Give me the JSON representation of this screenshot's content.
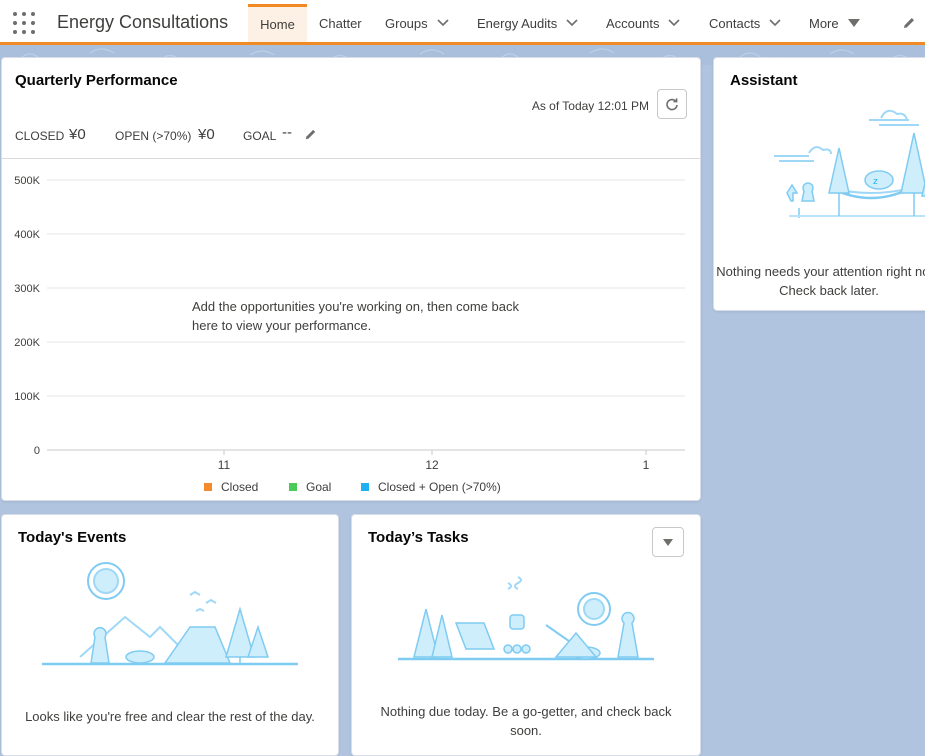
{
  "app": {
    "name": "Energy Consultations",
    "nav": [
      {
        "label": "Home",
        "active": true,
        "has_menu": false
      },
      {
        "label": "Chatter",
        "active": false,
        "has_menu": false
      },
      {
        "label": "Groups",
        "active": false,
        "has_menu": true
      },
      {
        "label": "Energy Audits",
        "active": false,
        "has_menu": true
      },
      {
        "label": "Accounts",
        "active": false,
        "has_menu": true
      },
      {
        "label": "Contacts",
        "active": false,
        "has_menu": true
      },
      {
        "label": "More",
        "active": false,
        "has_menu": true
      }
    ],
    "accent_color": "#f08a24"
  },
  "performance": {
    "title": "Quarterly Performance",
    "as_of": "As of Today 12:01 PM",
    "closed_label": "CLOSED",
    "closed_value": "¥0",
    "open_label": "OPEN (>70%)",
    "open_value": "¥0",
    "goal_label": "GOAL",
    "goal_value": "--",
    "empty_message": "Add the opportunities you're working on, then come back here to view your performance."
  },
  "chart_data": {
    "type": "line",
    "categories": [
      "11",
      "12",
      "1"
    ],
    "y_ticks": [
      "500K",
      "400K",
      "300K",
      "200K",
      "100K",
      "0"
    ],
    "ylim": [
      0,
      500000
    ],
    "grid": true,
    "legend_position": "bottom",
    "series": [
      {
        "name": "Closed",
        "color": "#f38b2c",
        "values": []
      },
      {
        "name": "Goal",
        "color": "#4bca58",
        "values": []
      },
      {
        "name": "Closed + Open (>70%)",
        "color": "#1fb0f0",
        "values": []
      }
    ]
  },
  "assistant": {
    "title": "Assistant",
    "message": "Nothing needs your attention right now. Check back later."
  },
  "events": {
    "title": "Today's Events",
    "message": "Looks like you're free and clear the rest of the day."
  },
  "tasks": {
    "title": "Today’s Tasks",
    "message": "Nothing due today. Be a go-getter, and check back soon."
  }
}
